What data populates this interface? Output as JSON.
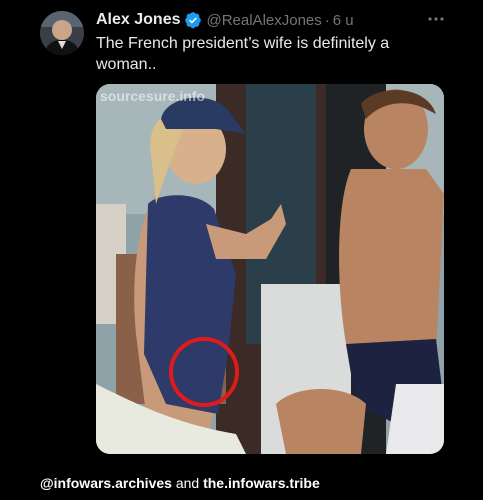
{
  "colors": {
    "background": "#000000",
    "text_primary": "#e7e9ea",
    "text_secondary": "#71767b",
    "verified_badge": "#1d9bf0",
    "highlight_circle": "#e01b1b"
  },
  "tweet": {
    "author": {
      "display_name": "Alex Jones",
      "handle": "@RealAlexJones",
      "verified_icon": "verified-badge-icon",
      "avatar_icon": "avatar-photo"
    },
    "separator": "·",
    "time": "6 u",
    "more_icon": "more-horizontal-icon",
    "text": "The French president’s wife is definitely a woman..",
    "media": {
      "watermark": "sourcesure.info",
      "description_icon": "photo-image"
    }
  },
  "caption": {
    "account_1": "@infowars.archives",
    "connector": " and ",
    "account_2": "the.infowars.tribe"
  }
}
